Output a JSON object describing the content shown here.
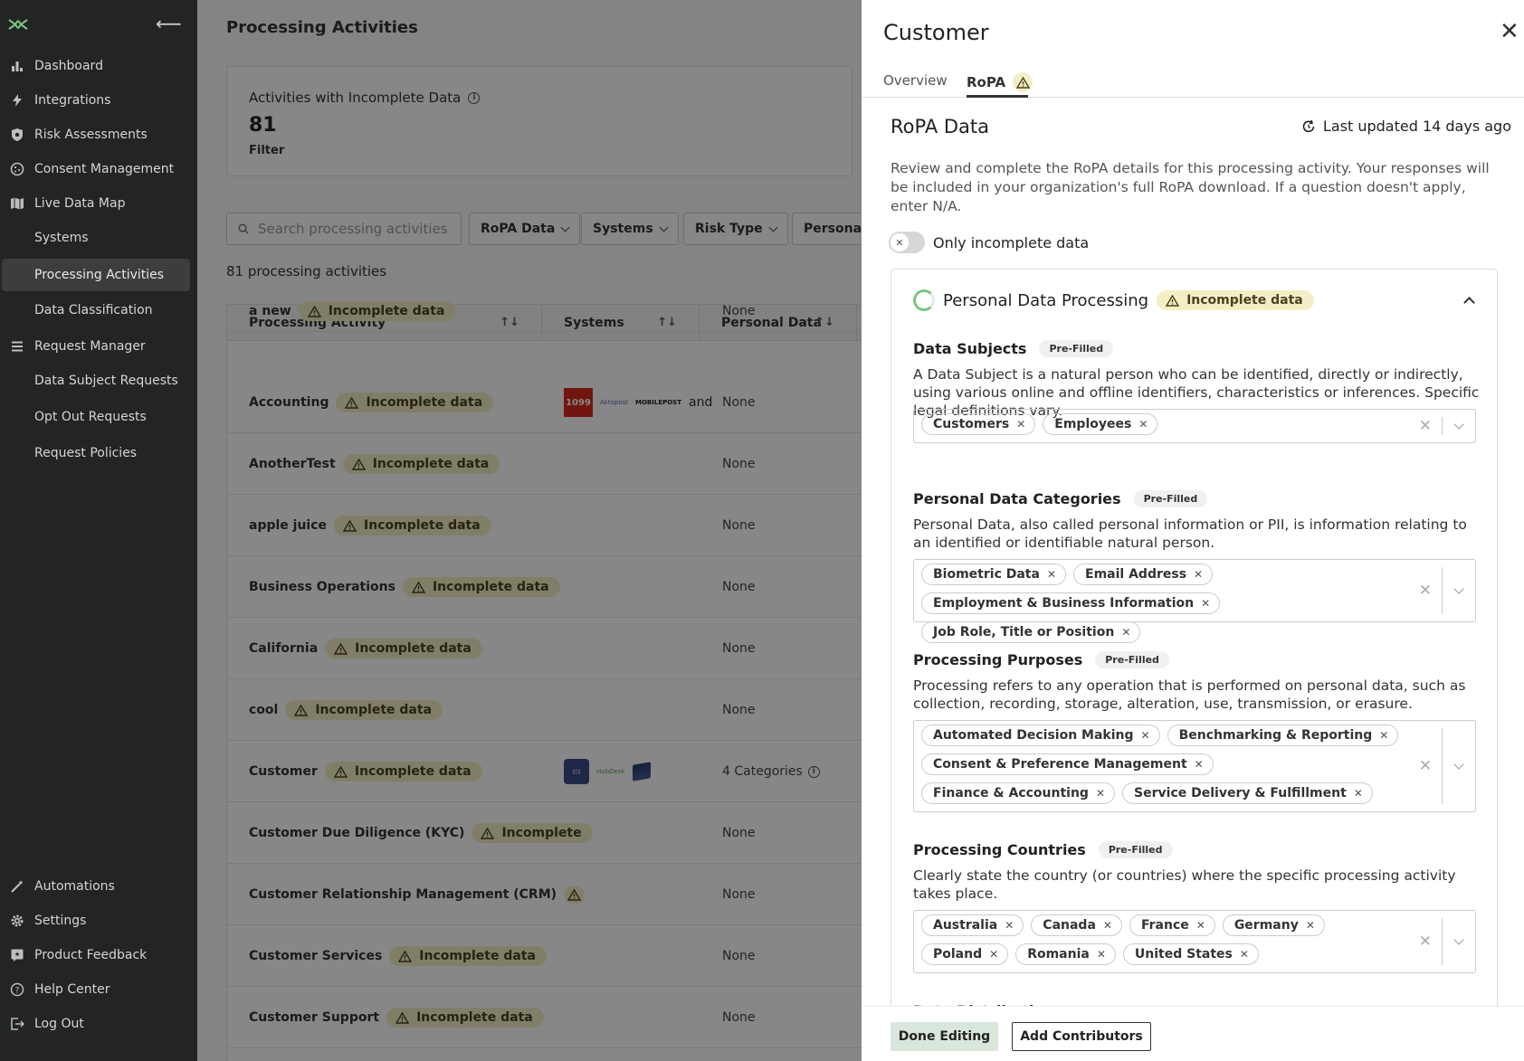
{
  "sidebar": {
    "items": [
      {
        "label": "Dashboard"
      },
      {
        "label": "Integrations"
      },
      {
        "label": "Risk Assessments"
      },
      {
        "label": "Consent Management"
      },
      {
        "label": "Live Data Map"
      },
      {
        "label": "Systems"
      },
      {
        "label": "Processing Activities"
      },
      {
        "label": "Data Classification"
      },
      {
        "label": "Request Manager"
      },
      {
        "label": "Data Subject Requests"
      },
      {
        "label": "Opt Out Requests"
      },
      {
        "label": "Request Policies"
      }
    ],
    "bottom": [
      {
        "label": "Automations"
      },
      {
        "label": "Settings"
      },
      {
        "label": "Product Feedback"
      },
      {
        "label": "Help Center"
      },
      {
        "label": "Log Out"
      }
    ]
  },
  "main": {
    "title": "Processing Activities",
    "card": {
      "label": "Activities with Incomplete Data",
      "value": "81",
      "filter": "Filter"
    },
    "search_placeholder": "Search processing activities",
    "filters": [
      "RoPA Data",
      "Systems",
      "Risk Type",
      "Personal D"
    ],
    "count_text": "81 processing activities",
    "columns": [
      "Processing Activity",
      "Systems",
      "Personal Data"
    ],
    "incomplete_label": "Incomplete data",
    "rows": [
      {
        "name": "a new",
        "badge": "Incomplete data",
        "personal": "None"
      },
      {
        "name": "Accounting",
        "badge": "Incomplete data",
        "personal": "None",
        "systems_more": "and"
      },
      {
        "name": "AnotherTest",
        "badge": "Incomplete data",
        "personal": "None"
      },
      {
        "name": "apple juice",
        "badge": "Incomplete data",
        "personal": "None"
      },
      {
        "name": "Business Operations",
        "badge": "Incomplete data",
        "personal": "None"
      },
      {
        "name": "California",
        "badge": "Incomplete data",
        "personal": "None"
      },
      {
        "name": "cool",
        "badge": "Incomplete data",
        "personal": "None"
      },
      {
        "name": "Customer",
        "badge": "Incomplete data",
        "personal": "4 Categories"
      },
      {
        "name": "Customer Due Diligence (KYC)",
        "badge": "Incomplete",
        "personal": "None"
      },
      {
        "name": "Customer Relationship Management (CRM)",
        "badge": "",
        "personal": "None"
      },
      {
        "name": "Customer Services",
        "badge": "Incomplete data",
        "personal": "None"
      },
      {
        "name": "Customer Support",
        "badge": "Incomplete data",
        "personal": "None"
      }
    ],
    "system_logos": {
      "logo_1099": "1099",
      "zeta": "Aktopost",
      "mobile": "MOBILEPOST",
      "helpdesk": "HubDesk"
    }
  },
  "drawer": {
    "title": "Customer",
    "tabs": [
      "Overview",
      "RoPA"
    ],
    "section_title": "RoPA Data",
    "last_updated": "Last updated 14 days ago",
    "description": "Review and complete the RoPA details for this processing activity. Your responses will be included in your organization's full RoPA download. If a question doesn't apply, enter N/A.",
    "toggle_label": "Only incomplete data",
    "panel_title": "Personal Data Processing",
    "panel_badge": "Incomplete data",
    "prefilled": "Pre-Filled",
    "fields": [
      {
        "title": "Data Subjects",
        "desc": "A Data Subject is a natural person who can be identified, directly or indirectly, using various online and offline identifiers, characteristics or inferences. Specific legal definitions vary.",
        "chips": [
          "Customers",
          "Employees"
        ]
      },
      {
        "title": "Personal Data Categories",
        "desc": "Personal Data, also called personal information or PII, is information relating to an identified or identifiable natural person.",
        "chips": [
          "Biometric Data",
          "Email Address",
          "Employment & Business Information",
          "Job Role, Title or Position"
        ]
      },
      {
        "title": "Processing Purposes",
        "desc": "Processing refers to any operation that is performed on personal data, such as collection, recording, storage, alteration, use, transmission, or erasure.",
        "chips": [
          "Automated Decision Making",
          "Benchmarking & Reporting",
          "Consent & Preference Management",
          "Finance & Accounting",
          "Service Delivery & Fulfillment"
        ]
      },
      {
        "title": "Processing Countries",
        "desc": "Clearly state the country (or countries) where the specific processing activity takes place.",
        "chips": [
          "Australia",
          "Canada",
          "France",
          "Germany",
          "Poland",
          "Romania",
          "United States"
        ]
      },
      {
        "title": "Data Distribution"
      }
    ],
    "footer": {
      "done": "Done Editing",
      "add": "Add Contributors"
    }
  },
  "colors": {
    "sidebar_bg": "#222524",
    "badge_bg": "#f4eec4",
    "accent_green": "#7cc684"
  }
}
